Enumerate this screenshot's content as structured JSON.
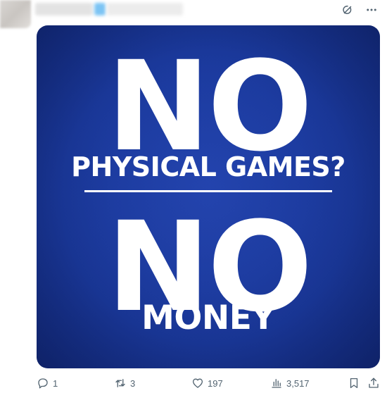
{
  "post": {
    "image_text": {
      "headline_1": "NO",
      "subline_1": "PHYSICAL GAMES?",
      "headline_2": "NO",
      "subline_2": "MONEY"
    },
    "image_colors": {
      "background": "#1b3a9e",
      "text": "#ffffff"
    }
  },
  "header_icons": [
    "grok-icon",
    "more-icon"
  ],
  "actions": {
    "replies": "1",
    "reposts": "3",
    "likes": "197",
    "views": "3,517"
  }
}
